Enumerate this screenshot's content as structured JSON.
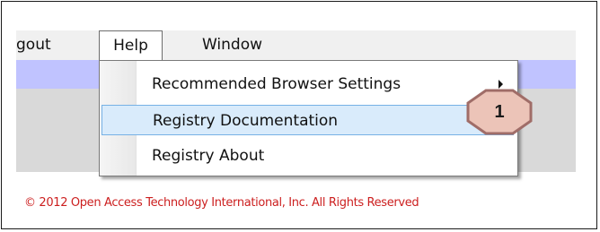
{
  "menubar": {
    "items": [
      {
        "label": "gout"
      },
      {
        "label": "Help"
      },
      {
        "label": "Window"
      }
    ]
  },
  "help_menu": {
    "items": [
      {
        "label": "Recommended Browser Settings",
        "has_submenu": true
      },
      {
        "label": "Registry Documentation",
        "highlighted": true
      },
      {
        "label": "Registry About"
      }
    ]
  },
  "callout": {
    "number": "1",
    "fill_color": "#ecc4b8",
    "stroke_color": "#a06d68"
  },
  "footer": {
    "copyright": "© 2012 Open Access Technology International, Inc. All Rights Reserved"
  },
  "colors": {
    "menubar_bg": "#f0f0f0",
    "strip": "#c0c3ff",
    "content_bg": "#d9d9d9",
    "highlight": "#d9ebfb",
    "footer_text": "#cc1f1f"
  }
}
